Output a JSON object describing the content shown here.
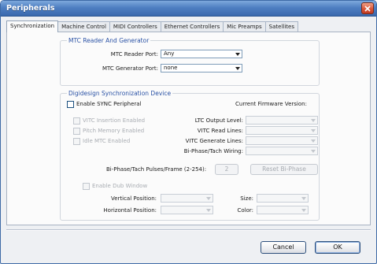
{
  "window": {
    "title": "Peripherals"
  },
  "tabs": [
    {
      "label": "Synchronization",
      "active": true
    },
    {
      "label": "Machine Control"
    },
    {
      "label": "MIDI Controllers"
    },
    {
      "label": "Ethernet Controllers"
    },
    {
      "label": "Mic Preamps"
    },
    {
      "label": "Satellites"
    }
  ],
  "mtc": {
    "group_title": "MTC Reader And Generator",
    "reader_label": "MTC Reader Port:",
    "reader_value": "Any",
    "generator_label": "MTC Generator Port:",
    "generator_value": "none"
  },
  "sync": {
    "group_title": "Digidesign Synchronization Device",
    "enable_label": "Enable SYNC Peripheral",
    "firmware_label": "Current Firmware Version:",
    "vitc_insertion": "VITC Insertion Enabled",
    "pitch_memory": "Pitch Memory Enabled",
    "idle_mtc": "Idle MTC Enabled",
    "ltc_output_label": "LTC Output Level:",
    "vitc_read_label": "VITC Read Lines:",
    "vitc_generate_label": "VITC Generate Lines:",
    "biphase_wiring_label": "Bi-Phase/Tach Wiring:",
    "pulses_label": "Bi-Phase/Tach Pulses/Frame (2-254):",
    "pulses_value": "2",
    "reset_label": "Reset Bi-Phase",
    "dub_window_label": "Enable Dub Window",
    "vertical_label": "Vertical Position:",
    "horizontal_label": "Horizontal Position:",
    "size_label": "Size:",
    "color_label": "Color:"
  },
  "buttons": {
    "cancel": "Cancel",
    "ok": "OK"
  },
  "icons": {
    "close": "close-icon",
    "dropdown": "chevron-down-icon"
  },
  "colors": {
    "accent": "#2a52a5",
    "titlebar": "#4f7fc2",
    "close": "#d9573a"
  }
}
